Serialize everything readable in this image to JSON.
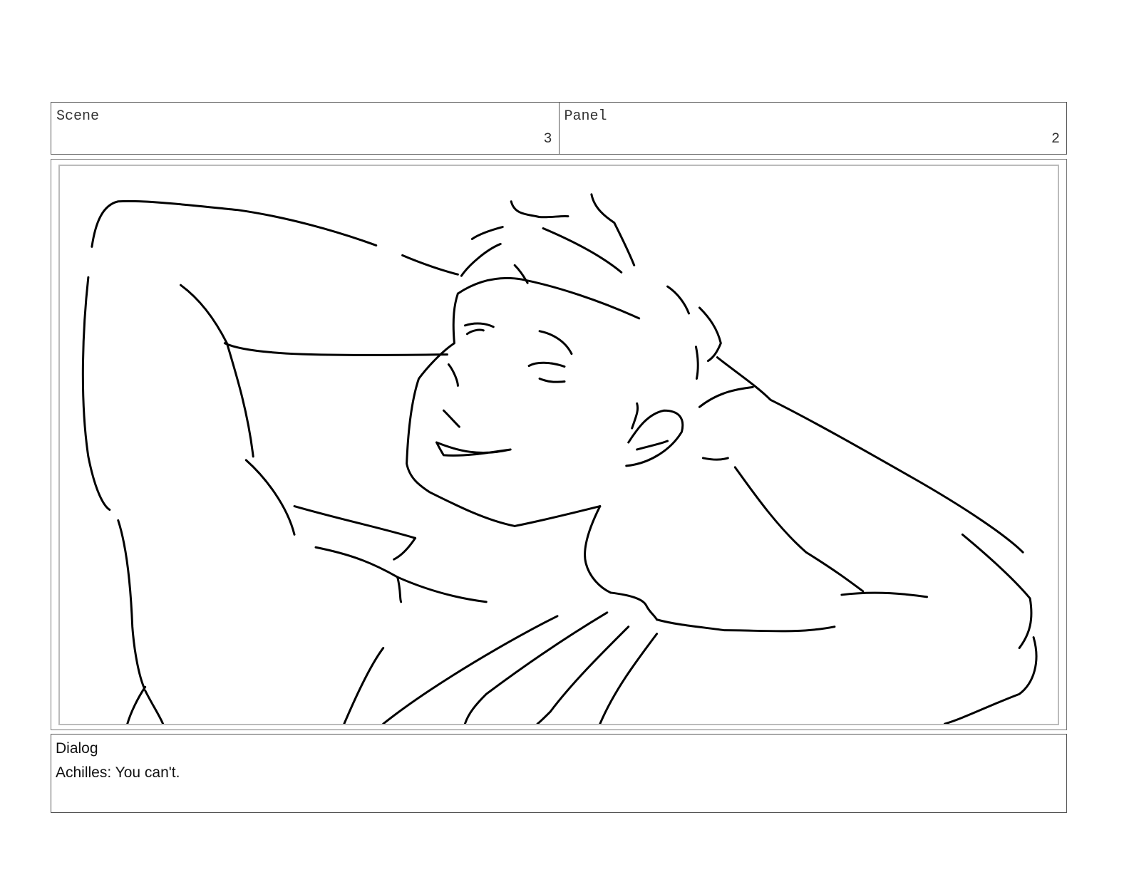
{
  "header": {
    "scene_label": "Scene",
    "scene_value": "3",
    "panel_label": "Panel",
    "panel_value": "2"
  },
  "panel_image": {
    "icon": "sketch-character-reclining-icon"
  },
  "dialog": {
    "label": "Dialog",
    "text": "Achilles: You can't."
  }
}
